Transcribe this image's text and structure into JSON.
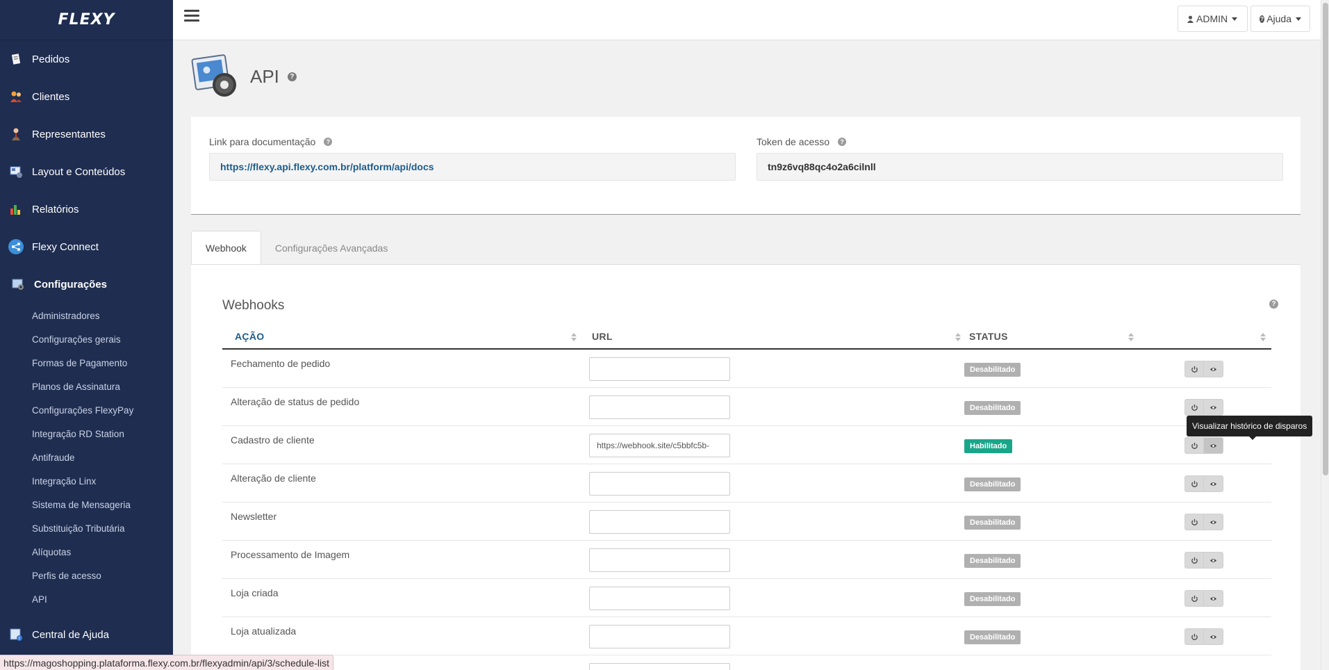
{
  "brand": {
    "logo_text": "FLEXY"
  },
  "sidebar": {
    "main_items": [
      {
        "label": "Pedidos",
        "icon": "orders-icon"
      },
      {
        "label": "Clientes",
        "icon": "clients-icon"
      },
      {
        "label": "Representantes",
        "icon": "representatives-icon"
      },
      {
        "label": "Layout e Conteúdos",
        "icon": "layout-icon"
      },
      {
        "label": "Relatórios",
        "icon": "reports-icon"
      },
      {
        "label": "Flexy Connect",
        "icon": "share-icon"
      },
      {
        "label": "Configurações",
        "icon": "settings-icon",
        "active": true
      }
    ],
    "sub_items": [
      "Administradores",
      "Configurações gerais",
      "Formas de Pagamento",
      "Planos de Assinatura",
      "Configurações FlexyPay",
      "Integração RD Station",
      "Antifraude",
      "Integração Linx",
      "Sistema de Mensageria",
      "Substituição Tributária",
      "Alíquotas",
      "Perfis de acesso",
      "API"
    ],
    "help_center": {
      "label": "Central de Ajuda",
      "icon": "help-center-icon"
    }
  },
  "topbar": {
    "admin_label": "ADMIN",
    "help_label": "Ajuda"
  },
  "page": {
    "title": "API",
    "doc_label": "Link para documentação",
    "doc_url": "https://flexy.api.flexy.com.br/platform/api/docs",
    "token_label": "Token de acesso",
    "token_value": "tn9z6vq88qc4o2a6cilnll"
  },
  "tabs": [
    {
      "label": "Webhook",
      "active": true
    },
    {
      "label": "Configurações Avançadas",
      "active": false
    }
  ],
  "webhooks": {
    "title": "Webhooks",
    "columns": {
      "action": "AÇÃO",
      "url": "URL",
      "status": "STATUS"
    },
    "rows": [
      {
        "action": "Fechamento de pedido",
        "url": "",
        "status": "Desabilitado",
        "enabled": false
      },
      {
        "action": "Alteração de status de pedido",
        "url": "",
        "status": "Desabilitado",
        "enabled": false
      },
      {
        "action": "Cadastro de cliente",
        "url": "https://webhook.site/c5bbfc5b-",
        "status": "Habilitado",
        "enabled": true
      },
      {
        "action": "Alteração de cliente",
        "url": "",
        "status": "Desabilitado",
        "enabled": false
      },
      {
        "action": "Newsletter",
        "url": "",
        "status": "Desabilitado",
        "enabled": false
      },
      {
        "action": "Processamento de Imagem",
        "url": "",
        "status": "Desabilitado",
        "enabled": false
      },
      {
        "action": "Loja criada",
        "url": "",
        "status": "Desabilitado",
        "enabled": false
      },
      {
        "action": "Loja atualizada",
        "url": "",
        "status": "Desabilitado",
        "enabled": false
      },
      {
        "action": "",
        "url": "",
        "status": "",
        "enabled": false
      }
    ],
    "tooltip": "Visualizar histórico de disparos"
  },
  "status_bar_url": "https://magoshopping.plataforma.flexy.com.br/flexyadmin/api/3/schedule-list",
  "colors": {
    "sidebar_bg": "#1f2d50",
    "link": "#1d5d8d",
    "enabled_badge": "#18a689",
    "disabled_badge": "#b0b0b0"
  }
}
